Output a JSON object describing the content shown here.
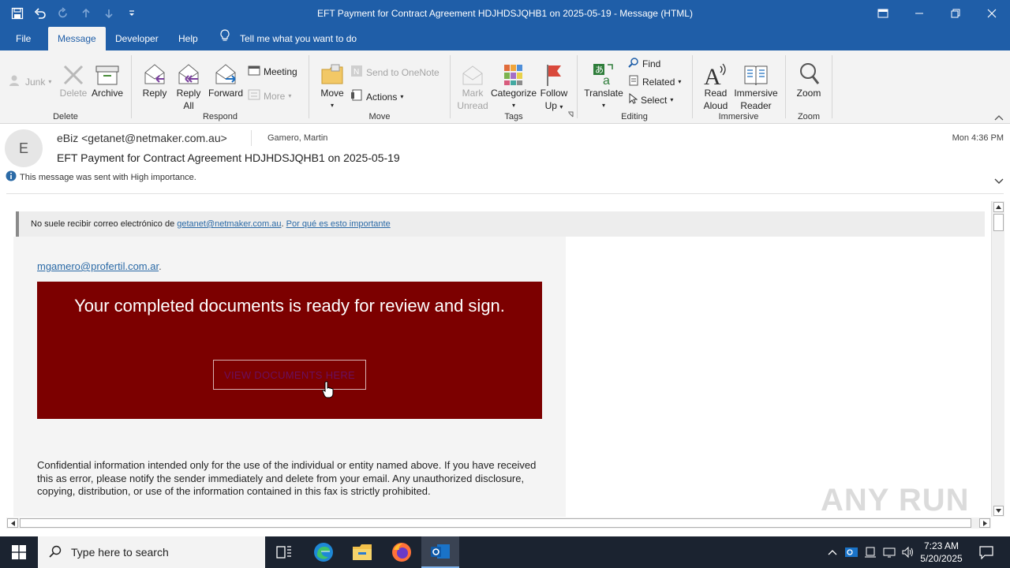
{
  "window": {
    "title": "EFT Payment for Contract Agreement HDJHDSJQHB1 on 2025-05-19  -  Message (HTML)"
  },
  "tabs": [
    {
      "label": "File"
    },
    {
      "label": "Message"
    },
    {
      "label": "Developer"
    },
    {
      "label": "Help"
    }
  ],
  "tell_me": "Tell me what you want to do",
  "ribbon": {
    "delete_group": {
      "label": "Delete",
      "junk": "Junk",
      "delete": "Delete",
      "archive": "Archive"
    },
    "respond_group": {
      "label": "Respond",
      "reply": "Reply",
      "reply_all_1": "Reply",
      "reply_all_2": "All",
      "forward": "Forward",
      "meeting": "Meeting",
      "more": "More"
    },
    "move_group": {
      "label": "Move",
      "move": "Move",
      "send_onenote": "Send to OneNote",
      "actions": "Actions"
    },
    "tags_group": {
      "label": "Tags",
      "mark_unread_1": "Mark",
      "mark_unread_2": "Unread",
      "categorize": "Categorize",
      "follow_up_1": "Follow",
      "follow_up_2": "Up"
    },
    "editing_group": {
      "label": "Editing",
      "translate": "Translate",
      "find": "Find",
      "related": "Related",
      "select": "Select"
    },
    "immersive_group": {
      "label": "Immersive",
      "read_aloud_1": "Read",
      "read_aloud_2": "Aloud",
      "immersive_reader_1": "Immersive",
      "immersive_reader_2": "Reader"
    },
    "zoom_group": {
      "label": "Zoom",
      "zoom": "Zoom"
    }
  },
  "message": {
    "avatar_initial": "E",
    "from": "eBiz <getanet@netmaker.com.au>",
    "to": "Gamero, Martin",
    "date": "Mon 4:36 PM",
    "subject": "EFT Payment for Contract Agreement HDJHDSJQHB1 on 2025-05-19",
    "importance": "This message was sent with High importance."
  },
  "body": {
    "warning_prefix": "No suele recibir correo electrónico de ",
    "warning_email": "getanet@netmaker.com.au",
    "warning_sep": ". ",
    "warning_link": "Por qué es esto importante",
    "recipient_email": "mgamero@profertil.com.ar",
    "recipient_suffix": ".",
    "headline": "Your completed documents is ready for review and sign.",
    "button": "VIEW DOCUMENTS HERE",
    "disclaimer": "Confidential information intended only for the use of the individual or entity named above. If you have received this as error, please notify the sender immediately and delete from your email. Any unauthorized disclosure, copying, distribution, or use of the information contained in this fax is strictly prohibited."
  },
  "watermark": "ANY RUN",
  "taskbar": {
    "search_placeholder": "Type here to search",
    "time": "7:23 AM",
    "date": "5/20/2025"
  },
  "colors": {
    "titlebar": "#1f5ea8",
    "banner": "#7c0000",
    "link": "#2b6aa6"
  }
}
